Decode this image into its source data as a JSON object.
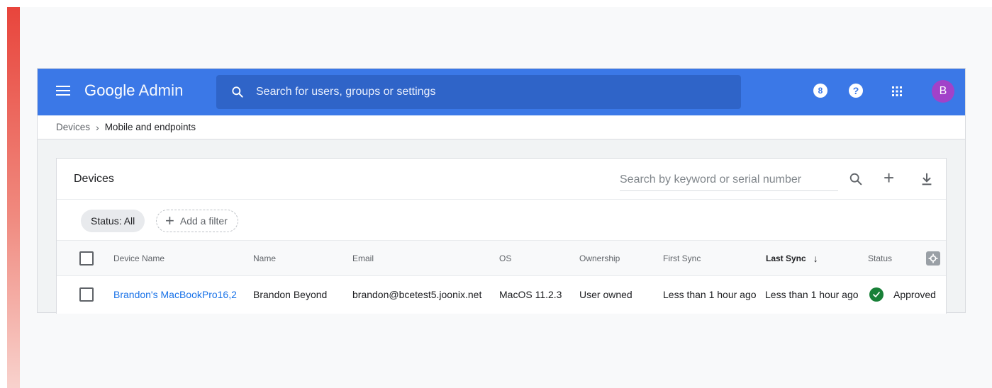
{
  "topbar": {
    "brand_google": "Google",
    "brand_admin": "Admin",
    "search_placeholder": "Search for users, groups or settings",
    "notification_count": "8",
    "help_label": "?",
    "avatar_initial": "B"
  },
  "breadcrumb": {
    "parent": "Devices",
    "separator": "›",
    "current": "Mobile and endpoints"
  },
  "card": {
    "title": "Devices",
    "search_placeholder": "Search by keyword or serial number",
    "add_symbol": "+"
  },
  "filters": {
    "status_chip": "Status: All",
    "add_filter_plus": "+",
    "add_filter_label": "Add a filter"
  },
  "table": {
    "columns": {
      "device_name": "Device Name",
      "name": "Name",
      "email": "Email",
      "os": "OS",
      "ownership": "Ownership",
      "first_sync": "First Sync",
      "last_sync": "Last Sync",
      "last_sync_sort": "↓",
      "status": "Status"
    },
    "rows": [
      {
        "device_name": "Brandon's MacBookPro16,2",
        "name": "Brandon Beyond",
        "email": "brandon@bcetest5.joonix.net",
        "os": "MacOS 11.2.3",
        "ownership": "User owned",
        "first_sync": "Less than 1 hour ago",
        "last_sync": "Less than 1 hour ago",
        "status": "Approved"
      }
    ]
  },
  "colors": {
    "topbar_blue": "#3b78e7",
    "search_blue": "#2f64c8",
    "avatar_purple": "#a142c9",
    "link_blue": "#1a73e8",
    "approved_green": "#188038",
    "accent_red": "#e8453c"
  }
}
